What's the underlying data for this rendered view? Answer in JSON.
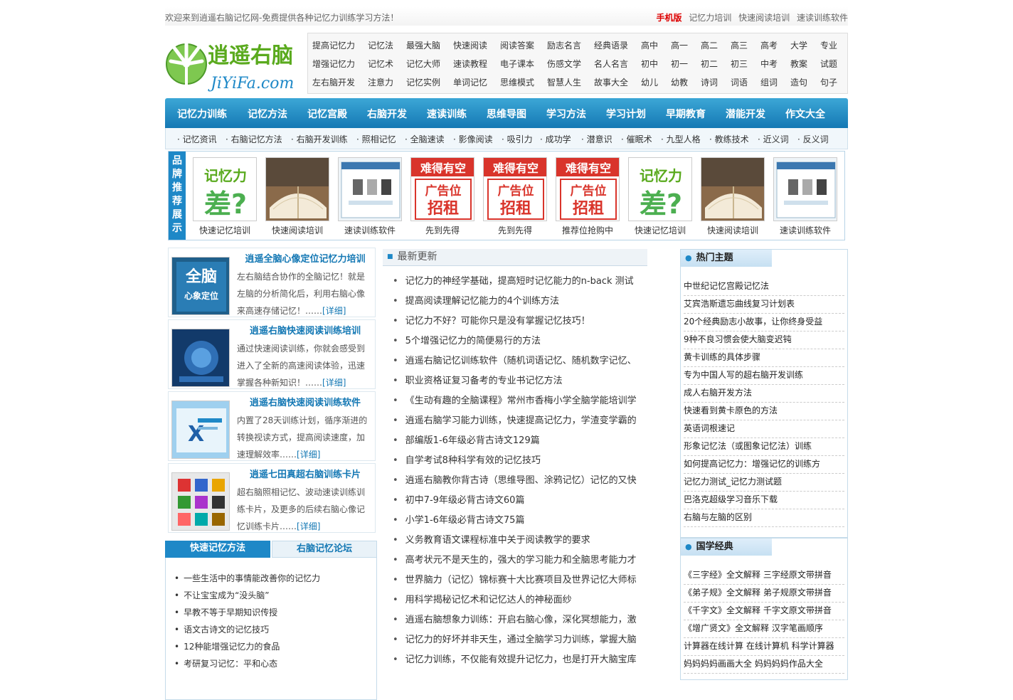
{
  "topbar": {
    "welcome": "欢迎来到逍遥右脑记忆网-免费提供各种记忆力训练学习方法！",
    "mobile": "手机版",
    "links": [
      "记忆力培训",
      "快速阅读培训",
      "速读训练软件"
    ]
  },
  "logo": {
    "text_top": "逍遥右脑",
    "text_bottom": "JiYiFa.com"
  },
  "nav_rows": [
    [
      "提高记忆力",
      "记忆法",
      "最强大脑",
      "快速阅读",
      "阅读答案",
      "励志名言",
      "经典语录",
      "高中",
      "高一",
      "高二",
      "高三",
      "高考",
      "大学",
      "专业"
    ],
    [
      "增强记忆力",
      "记忆术",
      "记忆大师",
      "速读教程",
      "电子课本",
      "伤感文学",
      "名人名言",
      "初中",
      "初一",
      "初二",
      "初三",
      "中考",
      "教案",
      "试题"
    ],
    [
      "左右脑开发",
      "注意力",
      "记忆实例",
      "单词记忆",
      "思维模式",
      "智慧人生",
      "故事大全",
      "幼儿",
      "幼教",
      "诗词",
      "词语",
      "组词",
      "造句",
      "句子"
    ]
  ],
  "mainnav": [
    "记忆力训练",
    "记忆方法",
    "记忆宫殿",
    "右脑开发",
    "速读训练",
    "思维导图",
    "学习方法",
    "学习计划",
    "早期教育",
    "潜能开发",
    "作文大全"
  ],
  "subnav": [
    "记忆资讯",
    "右脑记忆方法",
    "右脑开发训练",
    "照相记忆",
    "全脑速读",
    "影像阅读",
    "吸引力",
    "成功学",
    "潜意识",
    "催眠术",
    "九型人格",
    "教练技术",
    "近义词",
    "反义词"
  ],
  "brand": {
    "label": [
      "品",
      "牌",
      "推",
      "荐",
      "展",
      "示"
    ],
    "items": [
      {
        "caption": "快速记忆培训",
        "kind": "memory",
        "line1": "记忆力",
        "line2": "差?"
      },
      {
        "caption": "快速阅读培训",
        "kind": "book"
      },
      {
        "caption": "速读训练软件",
        "kind": "software"
      },
      {
        "caption": "先到先得",
        "kind": "ad",
        "line1": "难得有空",
        "line2": "广告位",
        "line3": "招租"
      },
      {
        "caption": "先到先得",
        "kind": "ad",
        "line1": "难得有空",
        "line2": "广告位",
        "line3": "招租"
      },
      {
        "caption": "推荐位抢购中",
        "kind": "ad",
        "line1": "难得有空",
        "line2": "广告位",
        "line3": "招租"
      },
      {
        "caption": "快速记忆培训",
        "kind": "memory",
        "line1": "记忆力",
        "line2": "差?"
      },
      {
        "caption": "快速阅读培训",
        "kind": "book"
      },
      {
        "caption": "速读训练软件",
        "kind": "software"
      }
    ]
  },
  "features": [
    {
      "title": "逍遥全脑心像定位记忆力培训",
      "img": "全脑",
      "img2": "心象定位",
      "desc": "左右脑结合协作的全脑记忆！就是左脑的分析简化后，利用右脑心像来高速存储记忆！……",
      "more": "[详细]"
    },
    {
      "title": "逍遥右脑快速阅读训练培训",
      "desc": "通过快速阅读训练，你就会感受到进入了全新的高速阅读体验，迅速掌握各种新知识！……",
      "more": "[详细]"
    },
    {
      "title": "逍遥右脑快速阅读训练软件",
      "desc": "内置了28天训练计划，循序渐进的转换视读方式，提高阅读速度，加速理解效率……",
      "more": "[详细]"
    },
    {
      "title": "逍遥七田真超右脑训练卡片",
      "desc": "超右脑照相记忆、波动速读训练训练卡片，及更多的后续右脑心像记忆训练卡片……",
      "more": "[详细]"
    }
  ],
  "tabs": {
    "active": "快速记忆方法",
    "inactive": "右脑记忆论坛",
    "items": [
      "一些生活中的事情能改善你的记忆力",
      "不让宝宝成为“没头脑”",
      "早教不等于早期知识传授",
      "语文古诗文的记忆技巧",
      "12种能增强记忆力的食品",
      "考研复习记忆：平和心态"
    ]
  },
  "latest": {
    "title": "最新更新",
    "items": [
      "记忆力的神经学基础，提高短时记忆能力的n-back 测试",
      "提高阅读理解记忆能力的4个训练方法",
      "记忆力不好？可能你只是没有掌握记忆技巧！",
      "5个增强记忆力的简便易行的方法",
      "逍遥右脑记忆训练软件（随机词语记忆、随机数字记忆、",
      "职业资格证复习备考的专业书记忆方法",
      "《生动有趣的全脑课程》常州市香梅小学全脑学能培训学",
      "逍遥右脑学习能力训练，快速提高记忆力，学渣变学霸的",
      "部编版1-6年级必背古诗文129篇",
      "自学考试8种科学有效的记忆技巧",
      "逍遥右脑教你背古诗（思维导图、涂鸦记忆）记忆的又快",
      "初中7-9年级必背古诗文60篇",
      "小学1-6年级必背古诗文75篇",
      "义务教育语文课程标准中关于阅读教学的要求",
      "高考状元不是天生的，强大的学习能力和全脑思考能力才",
      "世界脑力（记忆）锦标赛十大比赛项目及世界记忆大师标",
      "用科学揭秘记忆术和记忆达人的神秘面纱",
      "逍遥右脑想象力训练：开启右脑心像，深化冥想能力，激",
      "记忆力的好坏并非天生，通过全脑学习力训练，掌握大脑",
      "记忆力训练，不仅能有效提升记忆力，也是打开大脑宝库"
    ]
  },
  "hot": {
    "title": "热门主题",
    "items": [
      "中世纪记忆宫殿记忆法",
      "艾宾浩斯遗忘曲线复习计划表",
      "20个经典励志小故事，让你终身受益",
      "9种不良习惯会使大脑变迟钝",
      "黄卡训练的具体步骤",
      "专为中国人写的超右脑开发训练",
      "成人右脑开发方法",
      "快速看到黄卡原色的方法",
      "英语词根速记",
      "形象记忆法（或图象记忆法）训练",
      "如何提高记忆力：增强记忆的训练方",
      "记忆力测试_记忆力测试题",
      "巴洛克超级学习音乐下载",
      "右脑与左脑的区别"
    ]
  },
  "classic": {
    "title": "国学经典",
    "items": [
      "《三字经》全文解释  三字经原文带拼音",
      "《弟子规》全文解释  弟子规原文带拼音",
      "《千字文》全文解释  千字文原文带拼音",
      "《增广贤文》全文解释  汉字笔画顺序",
      "计算器在线计算  在线计算机  科学计算器",
      "妈妈妈妈画画大全  妈妈妈妈作品大全"
    ]
  },
  "colors": {
    "accent": "#1e88c7",
    "logo_green": "#8bc34a",
    "ad_red": "#d9342b"
  }
}
